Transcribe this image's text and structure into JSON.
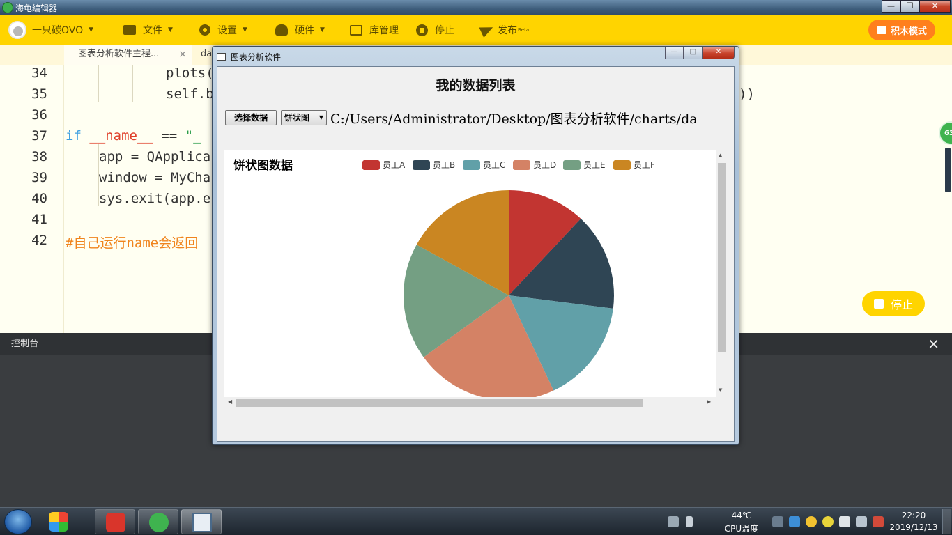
{
  "app": {
    "title": "海龟编辑器"
  },
  "window_controls": {
    "minimize": "—",
    "maximize": "❐",
    "close": "✕"
  },
  "toolbar": {
    "user": "一只碳OVO",
    "file": "文件",
    "settings": "设置",
    "hardware": "硬件",
    "library": "库管理",
    "stop": "停止",
    "publish": "发布",
    "publish_badge": "Beta",
    "block_mode": "积木模式"
  },
  "tabs": [
    {
      "label": "图表分析软件主程...",
      "close": "×"
    },
    {
      "label": "da"
    }
  ],
  "editor": {
    "lines": [
      {
        "no": "34",
        "text": "plots("
      },
      {
        "no": "35",
        "text": "self.b",
        "tail": "))"
      },
      {
        "no": "36",
        "text": ""
      },
      {
        "no": "37",
        "kw": "if",
        "dunder": "__name__",
        "op": " == ",
        "str": "\"_"
      },
      {
        "no": "38",
        "text": "app = QApplica"
      },
      {
        "no": "39",
        "text": "window = MyCha"
      },
      {
        "no": "40",
        "text": "sys.exit(app.e"
      },
      {
        "no": "41",
        "text": ""
      },
      {
        "no": "42",
        "comment": "#自己运行name会返回"
      }
    ],
    "stop_button": "停止",
    "side_badge": "63"
  },
  "console": {
    "title": "控制台",
    "close": "✕"
  },
  "dialog": {
    "title": "图表分析软件",
    "heading": "我的数据列表",
    "select_button": "选择数据",
    "chart_type": "饼状图",
    "file_path": "C:/Users/Administrator/Desktop/图表分析软件/charts/da",
    "min": "—",
    "max": "□",
    "close": "✕"
  },
  "chart_data": {
    "type": "pie",
    "title": "饼状图数据",
    "legend_position": "top",
    "categories": [
      "员工A",
      "员工B",
      "员工C",
      "员工D",
      "员工E",
      "员工F"
    ],
    "values": [
      12,
      15,
      16,
      22,
      18,
      17
    ],
    "colors": [
      "#c23531",
      "#2f4554",
      "#61a0a8",
      "#d48265",
      "#749f83",
      "#ca8622"
    ]
  },
  "taskbar": {
    "temp": "44℃",
    "temp_label": "CPU温度",
    "time": "22:20",
    "date": "2019/12/13"
  }
}
